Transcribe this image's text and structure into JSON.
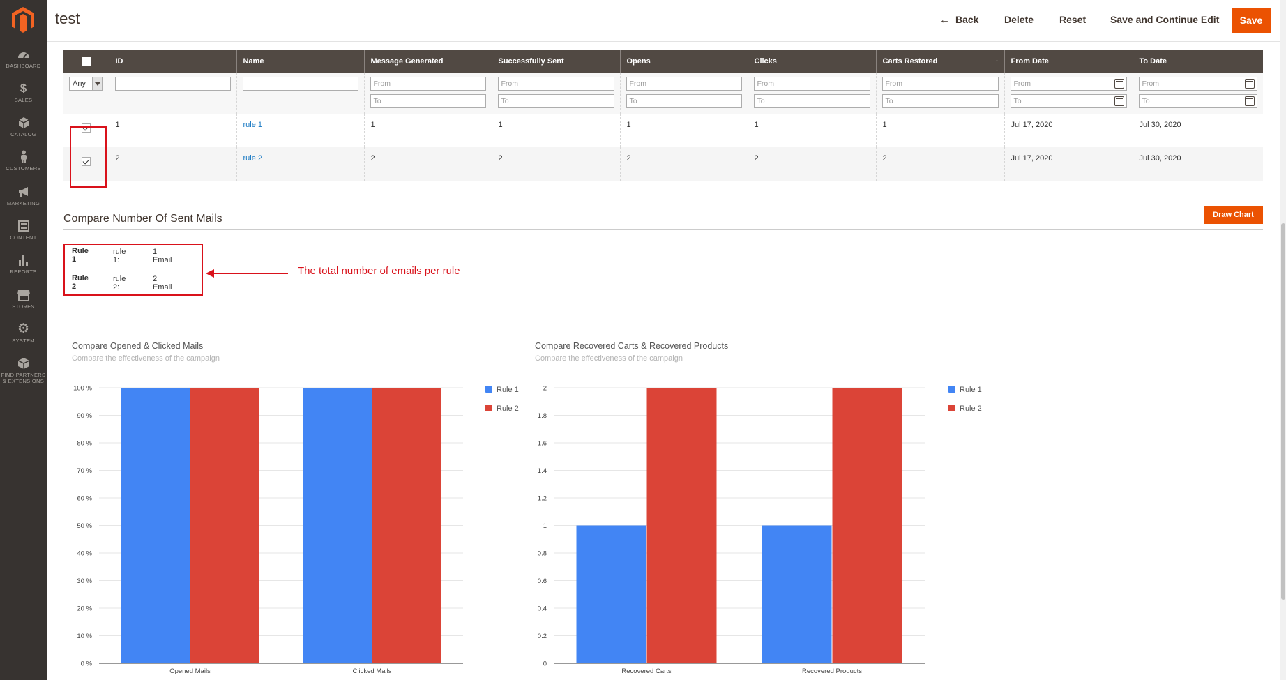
{
  "header": {
    "title": "test",
    "back_label": "Back",
    "delete_label": "Delete",
    "reset_label": "Reset",
    "save_continue_label": "Save and Continue Edit",
    "save_label": "Save"
  },
  "sidebar": {
    "items": [
      {
        "label": "DASHBOARD",
        "icon": "dashboard-icon"
      },
      {
        "label": "SALES",
        "icon": "dollar-icon"
      },
      {
        "label": "CATALOG",
        "icon": "box-icon"
      },
      {
        "label": "CUSTOMERS",
        "icon": "person-icon"
      },
      {
        "label": "MARKETING",
        "icon": "megaphone-icon"
      },
      {
        "label": "CONTENT",
        "icon": "layout-icon"
      },
      {
        "label": "REPORTS",
        "icon": "bar-chart-icon"
      },
      {
        "label": "STORES",
        "icon": "store-icon"
      },
      {
        "label": "SYSTEM",
        "icon": "gear-icon"
      },
      {
        "label": "FIND PARTNERS & EXTENSIONS",
        "icon": "cube-icon"
      }
    ]
  },
  "grid": {
    "columns": [
      "ID",
      "Name",
      "Message Generated",
      "Successfully Sent",
      "Opens",
      "Clicks",
      "Carts Restored",
      "From Date",
      "To Date"
    ],
    "filters": {
      "select_value": "Any",
      "from_placeholder": "From",
      "to_placeholder": "To"
    },
    "rows": [
      {
        "checked": true,
        "id": "1",
        "name": "rule 1",
        "generated": "1",
        "sent": "1",
        "opens": "1",
        "clicks": "1",
        "carts": "1",
        "from": "Jul 17, 2020",
        "to": "Jul 30, 2020"
      },
      {
        "checked": true,
        "id": "2",
        "name": "rule 2",
        "generated": "2",
        "sent": "2",
        "opens": "2",
        "clicks": "2",
        "carts": "2",
        "from": "Jul 17, 2020",
        "to": "Jul 30, 2020"
      }
    ]
  },
  "compare": {
    "title": "Compare Number Of Sent Mails",
    "draw_chart_label": "Draw Chart",
    "totals": [
      {
        "rule": "Rule 1",
        "name": "rule 1:",
        "value": "1 Email"
      },
      {
        "rule": "Rule 2",
        "name": "rule 2:",
        "value": "2 Email"
      }
    ],
    "annotation": "The total number of emails per rule"
  },
  "colors": {
    "rule1": "#4285f4",
    "rule2": "#db4437",
    "accent": "#eb5202",
    "annotation": "#d9121b"
  },
  "chart_data": [
    {
      "type": "bar",
      "title": "Compare Opened & Clicked Mails",
      "subtitle": "Compare the effectiveness of the campaign",
      "categories": [
        "Opened Mails",
        "Clicked Mails"
      ],
      "series": [
        {
          "name": "Rule 1",
          "values": [
            100,
            100
          ]
        },
        {
          "name": "Rule 2",
          "values": [
            100,
            100
          ]
        }
      ],
      "ylim": [
        0,
        100
      ],
      "yticks": [
        "0 %",
        "10 %",
        "20 %",
        "30 %",
        "40 %",
        "50 %",
        "60 %",
        "70 %",
        "80 %",
        "90 %",
        "100 %"
      ],
      "legend": "right"
    },
    {
      "type": "bar",
      "title": "Compare Recovered Carts & Recovered Products",
      "subtitle": "Compare the effectiveness of the campaign",
      "categories": [
        "Recovered Carts",
        "Recovered Products"
      ],
      "series": [
        {
          "name": "Rule 1",
          "values": [
            1,
            1
          ]
        },
        {
          "name": "Rule 2",
          "values": [
            2,
            2
          ]
        }
      ],
      "ylim": [
        0,
        2
      ],
      "yticks": [
        "0",
        "0.2",
        "0.4",
        "0.6",
        "0.8",
        "1",
        "1.2",
        "1.4",
        "1.6",
        "1.8",
        "2"
      ],
      "legend": "right"
    }
  ]
}
